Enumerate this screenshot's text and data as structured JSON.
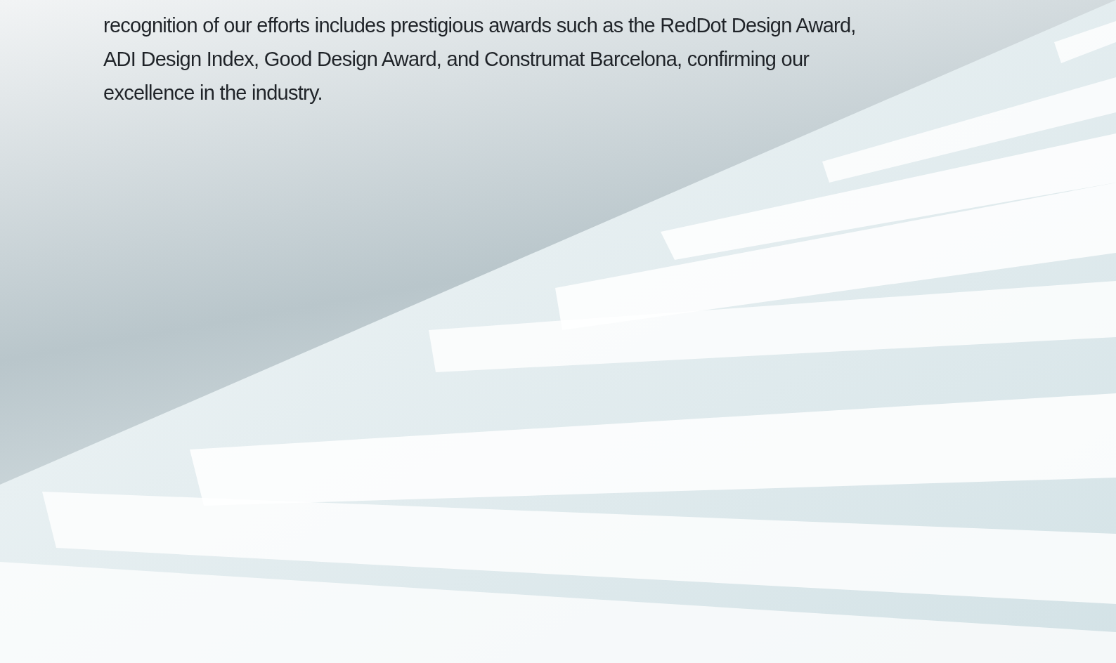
{
  "paragraph": "recognition of our efforts includes prestigious awards such as the RedDot Design Award, ADI Design Index, Good Design Award, and Construmat Barcelona, confirming our excellence in the industry."
}
